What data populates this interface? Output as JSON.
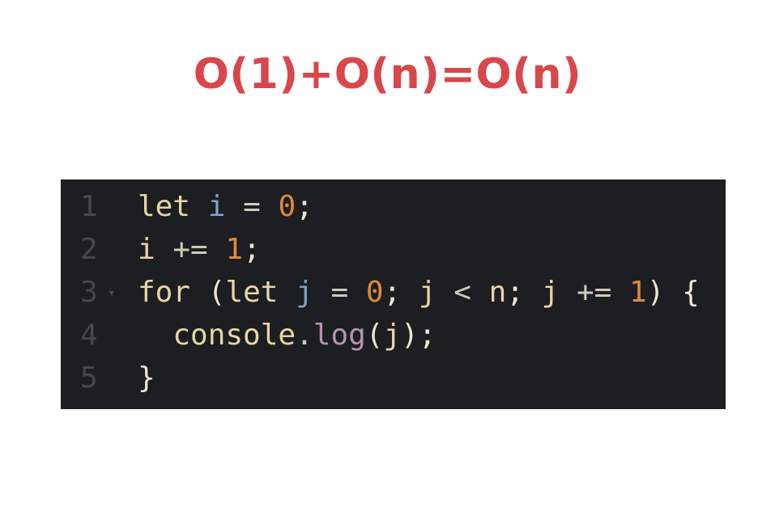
{
  "formula": "O(1)+O(n)=O(n)",
  "colors": {
    "formula": "#d9464b",
    "editor_background": "#1d1e22",
    "line_number": "#46484d",
    "keyword": "#e6d6a6",
    "variable": "#7fa2c9",
    "number": "#de8b39",
    "function": "#b693b0"
  },
  "editor": {
    "fold_icon": "caret-down-icon",
    "lines": [
      {
        "number": "1",
        "tokens": {
          "t1": "let",
          "t2": " ",
          "t3": "i",
          "t4": " = ",
          "t5": "0",
          "t6": ";"
        }
      },
      {
        "number": "2",
        "tokens": {
          "t1": "i",
          "t2": " += ",
          "t3": "1",
          "t4": ";"
        }
      },
      {
        "number": "3",
        "tokens": {
          "t1": "for",
          "t2": " (",
          "t3": "let",
          "t4": " ",
          "t5": "j",
          "t6": " = ",
          "t7": "0",
          "t8": "; ",
          "t9": "j",
          "t10": " < ",
          "t11": "n",
          "t12": "; ",
          "t13": "j",
          "t14": " += ",
          "t15": "1",
          "t16": ") {"
        }
      },
      {
        "number": "4",
        "tokens": {
          "t1": "  ",
          "t2": "console",
          "t3": ".",
          "t4": "log",
          "t5": "(",
          "t6": "j",
          "t7": ");"
        }
      },
      {
        "number": "5",
        "tokens": {
          "t1": "}"
        }
      }
    ]
  }
}
